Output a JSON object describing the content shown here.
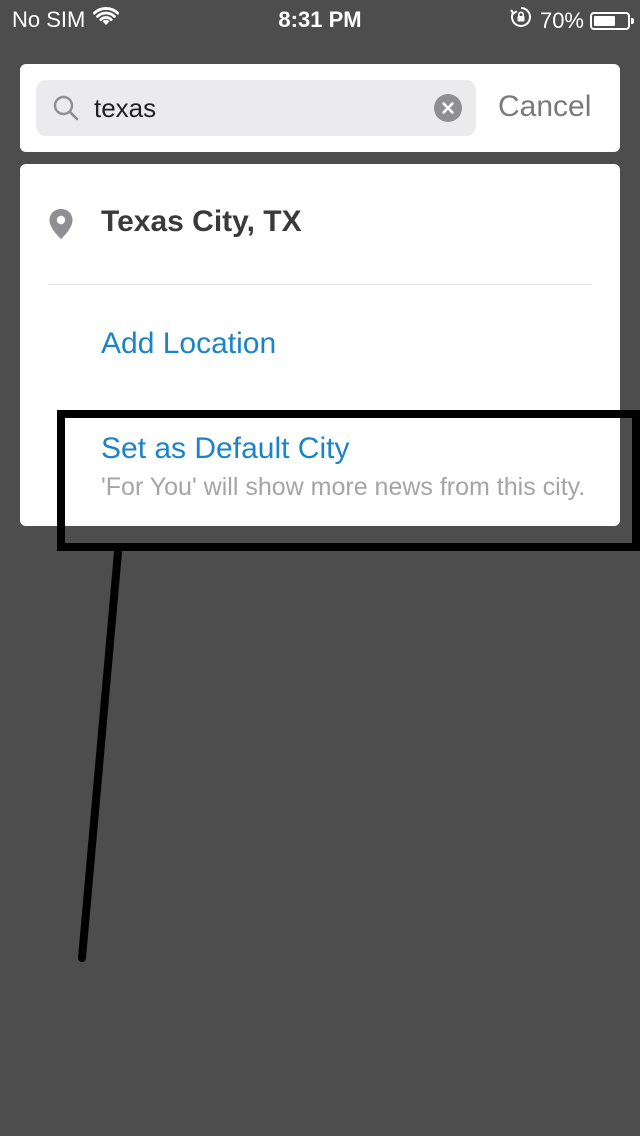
{
  "status_bar": {
    "carrier": "No SIM",
    "time": "8:31 PM",
    "battery_percent_label": "70%",
    "battery_level": 0.7
  },
  "search": {
    "query": "texas",
    "cancel_label": "Cancel"
  },
  "results": {
    "items": [
      {
        "label": "Texas City, TX",
        "icon": "location-pin-icon"
      }
    ],
    "add_location_label": "Add Location",
    "set_default_label": "Set as Default City",
    "set_default_description": "'For You' will show more news from this city."
  },
  "colors": {
    "backdrop": "#4d4d4d",
    "accent_blue": "#1a84c6",
    "secondary_text": "#a5a5a8",
    "annotation": "#000000"
  }
}
